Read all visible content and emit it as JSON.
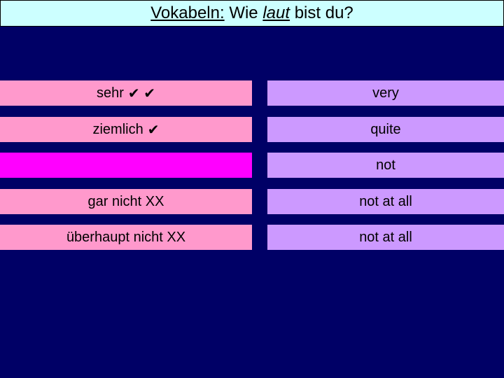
{
  "title": {
    "part1": "Vokabeln:",
    "part2": " Wie ",
    "part3": "laut",
    "part4": " bist du?"
  },
  "colors": {
    "background": "#000066",
    "title_bg": "#CCFFFF",
    "german_bg": "#FF99CC",
    "german_blank_bg": "#FF00FF",
    "english_bg": "#CC99FF"
  },
  "rows": [
    {
      "german": "sehr",
      "german_suffix": "✔ ✔",
      "english": "very"
    },
    {
      "german": "ziemlich",
      "german_suffix": "✔",
      "english": "quite"
    },
    {
      "german": "",
      "german_suffix": "",
      "english": "not"
    },
    {
      "german": "gar nicht XX",
      "german_suffix": "",
      "english": "not at all"
    },
    {
      "german": "überhaupt nicht XX",
      "german_suffix": "",
      "english": "not at all"
    }
  ]
}
